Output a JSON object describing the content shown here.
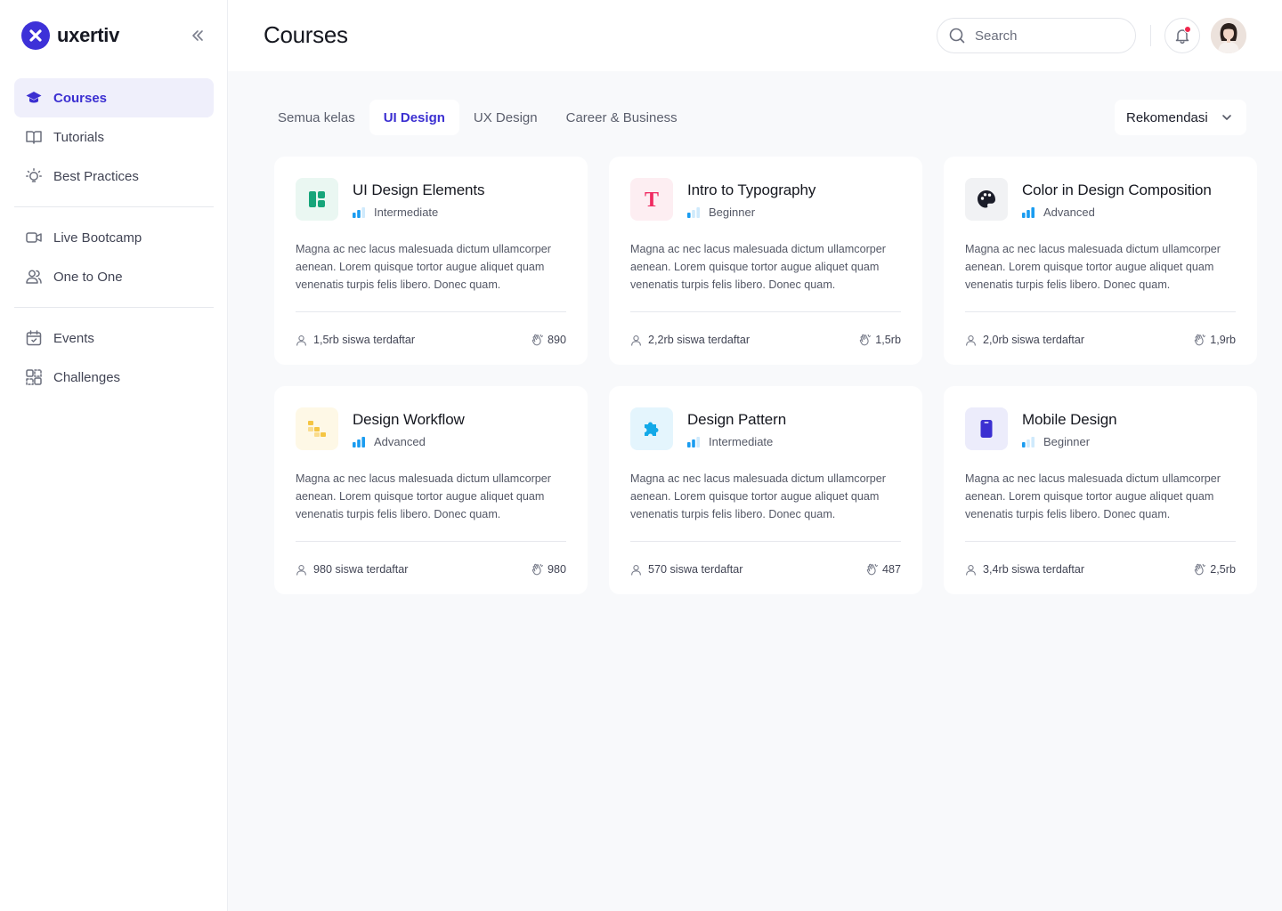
{
  "brand": {
    "name": "uxertiv"
  },
  "sidebar": {
    "groups": [
      [
        {
          "label": "Courses",
          "icon": "graduation-cap-icon",
          "active": true
        },
        {
          "label": "Tutorials",
          "icon": "book-open-icon",
          "active": false
        },
        {
          "label": "Best Practices",
          "icon": "lightbulb-icon",
          "active": false
        }
      ],
      [
        {
          "label": "Live Bootcamp",
          "icon": "video-camera-icon",
          "active": false
        },
        {
          "label": "One to One",
          "icon": "users-icon",
          "active": false
        }
      ],
      [
        {
          "label": "Events",
          "icon": "calendar-icon",
          "active": false
        },
        {
          "label": "Challenges",
          "icon": "challenge-grid-icon",
          "active": false
        }
      ]
    ]
  },
  "header": {
    "title": "Courses",
    "search_placeholder": "Search",
    "has_notification": true
  },
  "tabs": [
    {
      "label": "Semua kelas",
      "active": false
    },
    {
      "label": "UI Design",
      "active": true
    },
    {
      "label": "UX Design",
      "active": false
    },
    {
      "label": "Career & Business",
      "active": false
    }
  ],
  "sort": {
    "label": "Rekomendasi"
  },
  "courses": [
    {
      "title": "UI Design Elements",
      "level": "Intermediate",
      "level_bars": 2,
      "icon": "layout-icon",
      "icon_color": "#16a57a",
      "icon_bg": "#eaf7f2",
      "description": "Magna ac nec lacus malesuada dictum ullamcorper aenean. Lorem quisque tortor augue aliquet quam venenatis turpis felis libero. Donec quam.",
      "students": "1,5rb siswa terdaftar",
      "claps": "890"
    },
    {
      "title": "Intro to Typography",
      "level": "Beginner",
      "level_bars": 1,
      "icon": "typography-icon",
      "icon_color": "#ef2b62",
      "icon_bg": "#fdeef2",
      "description": "Magna ac nec lacus malesuada dictum ullamcorper aenean. Lorem quisque tortor augue aliquet quam venenatis turpis felis libero. Donec quam.",
      "students": "2,2rb siswa terdaftar",
      "claps": "1,5rb"
    },
    {
      "title": "Color in Design Composition",
      "level": "Advanced",
      "level_bars": 3,
      "icon": "palette-icon",
      "icon_color": "#1b1d29",
      "icon_bg": "#f1f2f4",
      "description": "Magna ac nec lacus malesuada dictum ullamcorper aenean. Lorem quisque tortor augue aliquet quam venenatis turpis felis libero. Donec quam.",
      "students": "2,0rb siswa terdaftar",
      "claps": "1,9rb"
    },
    {
      "title": "Design Workflow",
      "level": "Advanced",
      "level_bars": 3,
      "icon": "workflow-icon",
      "icon_color": "#f5c542",
      "icon_bg": "#fef8e6",
      "description": "Magna ac nec lacus malesuada dictum ullamcorper aenean. Lorem quisque tortor augue aliquet quam venenatis turpis felis libero. Donec quam.",
      "students": "980 siswa terdaftar",
      "claps": "980"
    },
    {
      "title": "Design Pattern",
      "level": "Intermediate",
      "level_bars": 2,
      "icon": "puzzle-icon",
      "icon_color": "#13a9e8",
      "icon_bg": "#e4f5fd",
      "description": "Magna ac nec lacus malesuada dictum ullamcorper aenean. Lorem quisque tortor augue aliquet quam venenatis turpis felis libero. Donec quam.",
      "students": "570 siswa terdaftar",
      "claps": "487"
    },
    {
      "title": "Mobile Design",
      "level": "Beginner",
      "level_bars": 1,
      "icon": "mobile-phone-icon",
      "icon_color": "#3b2fd1",
      "icon_bg": "#ececfb",
      "description": "Magna ac nec lacus malesuada dictum ullamcorper aenean. Lorem quisque tortor augue aliquet quam venenatis turpis felis libero. Donec quam.",
      "students": "3,4rb siswa terdaftar",
      "claps": "2,5rb"
    }
  ],
  "colors": {
    "accent": "#3b2fd1",
    "level_bar_on": "#1a9cf0",
    "level_bar_off": "#cfeafc"
  }
}
